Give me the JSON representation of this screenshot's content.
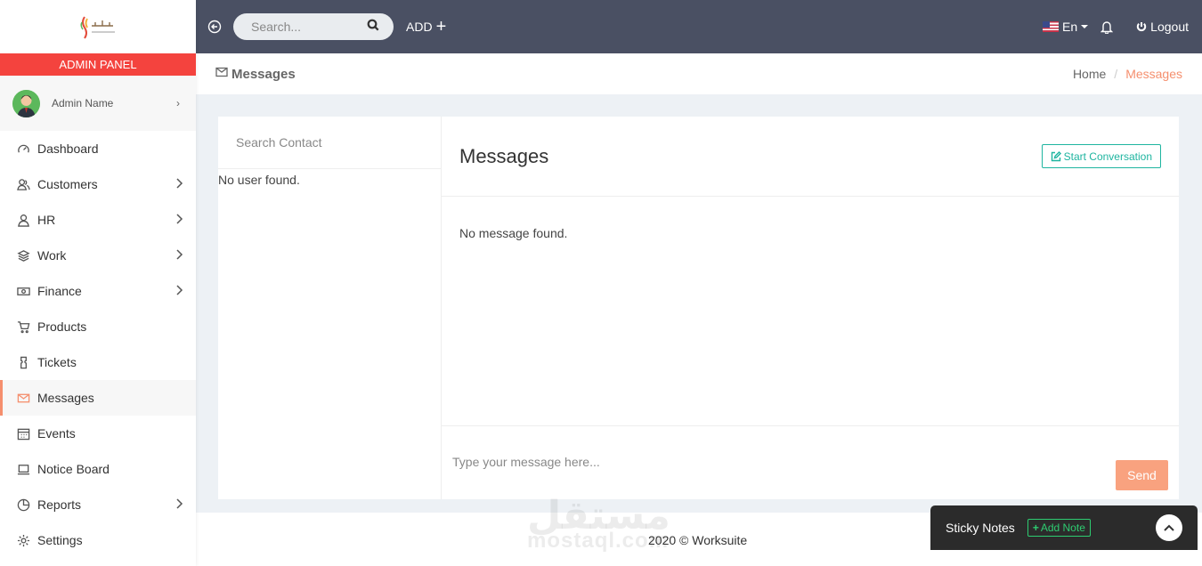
{
  "sidebar": {
    "panel_label": "ADMIN PANEL",
    "profile_name": "Admin Name",
    "items": [
      {
        "label": "Dashboard",
        "icon": "dashboard-icon",
        "chevron": false
      },
      {
        "label": "Customers",
        "icon": "users-icon",
        "chevron": true
      },
      {
        "label": "HR",
        "icon": "user-icon",
        "chevron": true
      },
      {
        "label": "Work",
        "icon": "layers-icon",
        "chevron": true
      },
      {
        "label": "Finance",
        "icon": "money-icon",
        "chevron": true
      },
      {
        "label": "Products",
        "icon": "cart-icon",
        "chevron": false
      },
      {
        "label": "Tickets",
        "icon": "ticket-icon",
        "chevron": false
      },
      {
        "label": "Messages",
        "icon": "envelope-icon",
        "chevron": false,
        "active": true
      },
      {
        "label": "Events",
        "icon": "calendar-icon",
        "chevron": false
      },
      {
        "label": "Notice Board",
        "icon": "laptop-icon",
        "chevron": false
      },
      {
        "label": "Reports",
        "icon": "pie-chart-icon",
        "chevron": true
      },
      {
        "label": "Settings",
        "icon": "gear-icon",
        "chevron": false
      }
    ]
  },
  "topbar": {
    "search_placeholder": "Search...",
    "add_label": "ADD",
    "language": "En",
    "logout_label": "Logout"
  },
  "titlebar": {
    "title": "Messages",
    "breadcrumb": {
      "home": "Home",
      "separator": "/",
      "current": "Messages"
    }
  },
  "contacts": {
    "search_placeholder": "Search Contact",
    "empty_text": "No user found."
  },
  "chat": {
    "title": "Messages",
    "start_button": "Start Conversation",
    "empty_text": "No message found.",
    "input_placeholder": "Type your message here...",
    "send_label": "Send"
  },
  "footer": {
    "text": "2020 © Worksuite",
    "watermark_ar": "مستقل",
    "watermark_en": "mostaql.com"
  },
  "sticky_notes": {
    "title": "Sticky Notes",
    "add_label": "Add Note"
  },
  "colors": {
    "admin_panel_bg": "#f4433e",
    "topbar_bg": "#4a5063",
    "accent": "#f58f6e",
    "teal": "#1fb5a0",
    "send_bg": "#f9a27f",
    "sticky_bg": "#2b2b2b",
    "add_note_green": "#2ecc71"
  }
}
